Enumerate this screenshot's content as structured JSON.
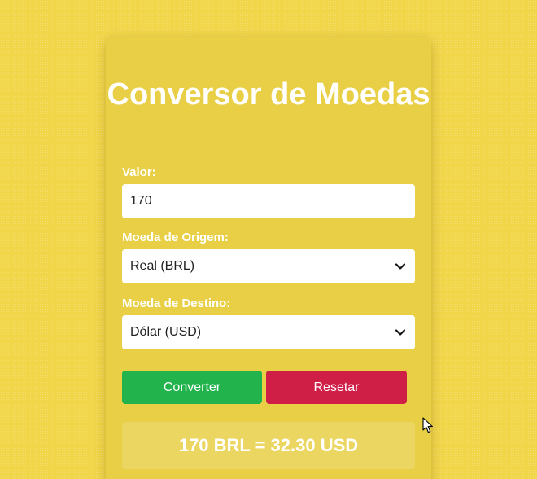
{
  "converter": {
    "title": "Conversor de Moedas",
    "amount_label": "Valor:",
    "amount_value": "170",
    "from_label": "Moeda de Origem:",
    "from_selected": "Real (BRL)",
    "to_label": "Moeda de Destino:",
    "to_selected": "Dólar (USD)",
    "convert_label": "Converter",
    "reset_label": "Resetar",
    "result_text": "170 BRL = 32.30 USD"
  },
  "icons": {
    "select_arrow": "chevron-down-icon",
    "pointer": "mouse-cursor-icon"
  },
  "colors": {
    "background": "#f2d64a",
    "card": "#e8cf45",
    "convert_button": "#22b34d",
    "reset_button": "#cf1f47",
    "text": "#ffffff"
  }
}
